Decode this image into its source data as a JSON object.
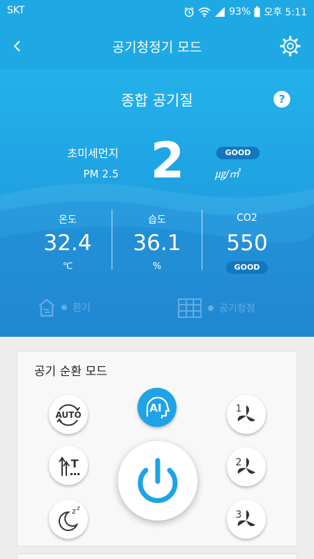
{
  "status_bar": {
    "carrier": "SKT",
    "battery": "93%",
    "time": "오후 5:11"
  },
  "app_bar": {
    "title": "공기청정기 모드",
    "back_icon": "chevron-left-icon",
    "settings_icon": "gear-icon"
  },
  "air_quality": {
    "title": "종합 공기질",
    "help_label": "?",
    "pm25": {
      "name": "초미세먼지",
      "sub": "PM 2.5",
      "value": "2",
      "status": "GOOD",
      "unit": "㎍/㎥"
    },
    "metrics": [
      {
        "label": "온도",
        "value": "32.4",
        "unit": "℃"
      },
      {
        "label": "습도",
        "value": "36.1",
        "unit": "%"
      },
      {
        "label": "CO2",
        "value": "550",
        "status": "GOOD"
      }
    ],
    "faded_items": [
      {
        "icon": "ventilation-icon",
        "label": "환기"
      },
      {
        "icon": "window-icon",
        "label": "공기청정"
      }
    ]
  },
  "circulation": {
    "title": "공기 순환 모드",
    "modes": [
      {
        "name": "auto",
        "label": "AUTO"
      },
      {
        "name": "ai",
        "label": "AI",
        "active": true
      },
      {
        "name": "fan-1",
        "label": "1"
      },
      {
        "name": "turbo",
        "label": "T"
      },
      {
        "name": "fan-2",
        "label": "2"
      },
      {
        "name": "sleep",
        "label": "z"
      },
      {
        "name": "fan-3",
        "label": "3"
      }
    ],
    "power_icon": "power-icon"
  },
  "colors": {
    "primary": "#1ea9e4",
    "hero_bottom": "#1b8fd9",
    "badge": "#1377be",
    "active": "#1ea3e6",
    "background": "#ededed"
  }
}
